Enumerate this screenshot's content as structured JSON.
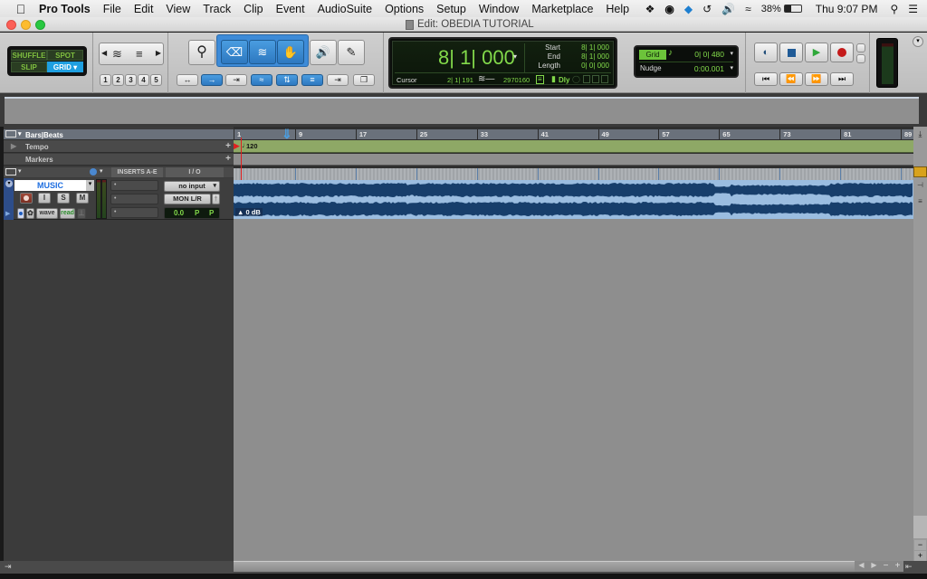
{
  "menubar": {
    "apple_icon": "",
    "app_name": "Pro Tools",
    "items": [
      "File",
      "Edit",
      "View",
      "Track",
      "Clip",
      "Event",
      "AudioSuite",
      "Options",
      "Setup",
      "Window",
      "Marketplace",
      "Help"
    ],
    "status": {
      "battery": "38%",
      "clock": "Thu 9:07 PM"
    }
  },
  "window": {
    "title": "Edit: OBEDIA TUTORIAL"
  },
  "edit_modes": {
    "shuffle": "SHUFFLE",
    "spot": "SPOT",
    "slip": "SLIP",
    "grid": "GRID",
    "active": "GRID"
  },
  "zoom_presets": [
    "1",
    "2",
    "3",
    "4",
    "5"
  ],
  "counter": {
    "main": "8| 1| 000",
    "start_label": "Start",
    "start": "8| 1| 000",
    "end_label": "End",
    "end": "8| 1| 000",
    "length_label": "Length",
    "length": "0| 0| 000",
    "cursor_label": "Cursor",
    "cursor": "2| 1| 191",
    "sample": "2970160",
    "dly_label": "Dly"
  },
  "grid_nudge": {
    "grid_label": "Grid",
    "grid_value": "0| 0| 480",
    "nudge_label": "Nudge",
    "nudge_value": "0:00.001"
  },
  "rulers": {
    "bars_beats_label": "Bars|Beats",
    "tempo_label": "Tempo",
    "markers_label": "Markers",
    "tempo_value": "120",
    "bar_ticks": [
      "1",
      "9",
      "17",
      "25",
      "33",
      "41",
      "49",
      "57",
      "65",
      "73",
      "81",
      "89"
    ]
  },
  "track_header": {
    "inserts": "INSERTS A-E",
    "io": "I / O"
  },
  "track": {
    "name": "MUSIC",
    "input": "no input",
    "output": "MON L/R",
    "volume": "0.0",
    "pan_l": "P",
    "pan_r": "P",
    "view": "wave",
    "automation": "read",
    "rec": "",
    "input_monitor": "I",
    "solo": "S",
    "mute": "M",
    "clip_gain": "0 dB"
  },
  "colors": {
    "accent_blue": "#1e9fe0",
    "counter_green": "#82d94a",
    "waveform_dark": "#173e6b",
    "waveform_light": "#9bbde0",
    "tempo_lane": "#8ea866"
  }
}
